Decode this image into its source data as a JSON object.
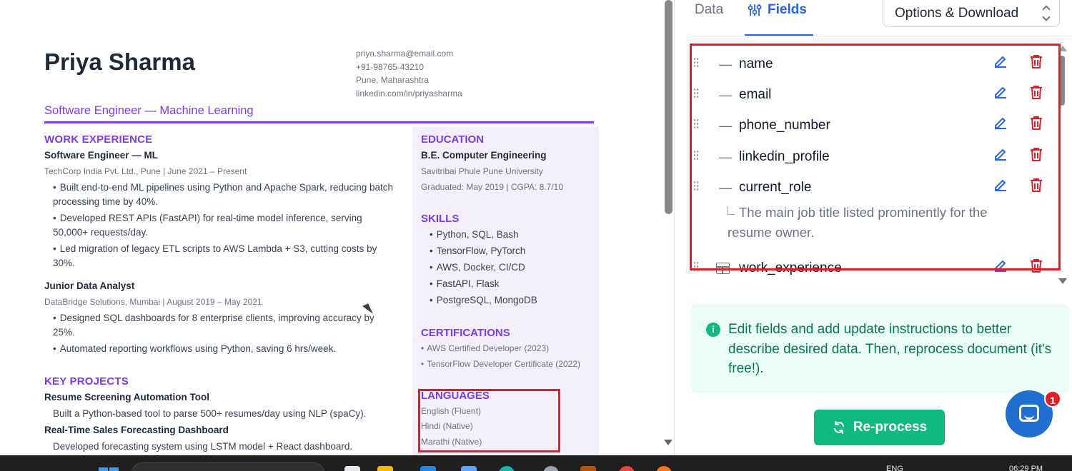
{
  "resume": {
    "name": "Priya Sharma",
    "contact": [
      "priya.sharma@email.com",
      "+91-98765-43210",
      "Pune, Maharashtra",
      "linkedin.com/in/priyasharma"
    ],
    "role": "Software Engineer — Machine Learning",
    "work_title": "WORK EXPERIENCE",
    "jobs": [
      {
        "title": "Software Engineer — ML",
        "meta": "TechCorp India Pvt. Ltd., Pune | June 2021 – Present",
        "bullets": [
          "Built end-to-end ML pipelines using Python and Apache Spark, reducing batch processing time by 40%.",
          "Developed REST APIs (FastAPI) for real-time model inference, serving 50,000+ requests/day.",
          "Led migration of legacy ETL scripts to AWS Lambda + S3, cutting costs by 30%."
        ]
      },
      {
        "title": "Junior Data Analyst",
        "meta": "DataBridge Solutions, Mumbai | August 2019 – May 2021",
        "bullets": [
          "Designed SQL dashboards for 8 enterprise clients, improving accuracy by 25%.",
          "Automated reporting workflows using Python, saving 6 hrs/week."
        ]
      }
    ],
    "projects_title": "KEY PROJECTS",
    "projects": [
      {
        "title": "Resume Screening Automation Tool",
        "desc": "Built a Python-based tool to parse 500+ resumes/day using NLP (spaCy)."
      },
      {
        "title": "Real-Time Sales Forecasting Dashboard",
        "desc": "Developed forecasting system using LSTM model + React dashboard."
      }
    ],
    "education_title": "EDUCATION",
    "degree": "B.E. Computer Engineering",
    "university": "Savitribai Phule Pune University",
    "graduated": "Graduated: May 2019 | CGPA: 8.7/10",
    "skills_title": "SKILLS",
    "skills": [
      "Python, SQL, Bash",
      "TensorFlow, PyTorch",
      "AWS, Docker, CI/CD",
      "FastAPI, Flask",
      "PostgreSQL, MongoDB"
    ],
    "cert_title": "CERTIFICATIONS",
    "certs": [
      "AWS Certified Developer (2023)",
      "TensorFlow Developer Certificate (2022)"
    ],
    "lang_title": "LANGUAGES",
    "languages": [
      "English (Fluent)",
      "Hindi (Native)",
      "Marathi (Native)"
    ]
  },
  "panel": {
    "tab_data": "Data",
    "tab_fields": "Fields",
    "options_label": "Options & Download",
    "fields": [
      "name",
      "email",
      "phone_number",
      "linkedin_profile",
      "current_role",
      "work_experience"
    ],
    "current_role_desc": "The main job title listed prominently for the resume owner.",
    "info_text": "Edit fields and add update instructions to better describe desired data. Then, reprocess document (it's free!).",
    "reprocess_label": "Re-process",
    "chat_badge": "1"
  },
  "taskbar": {
    "lang": "ENG",
    "time": "06:29 PM"
  },
  "colors": {
    "accent_purple": "#7c3aed",
    "accent_blue": "#2563eb",
    "accent_green": "#10b981",
    "highlight_red": "#e11d2a"
  }
}
